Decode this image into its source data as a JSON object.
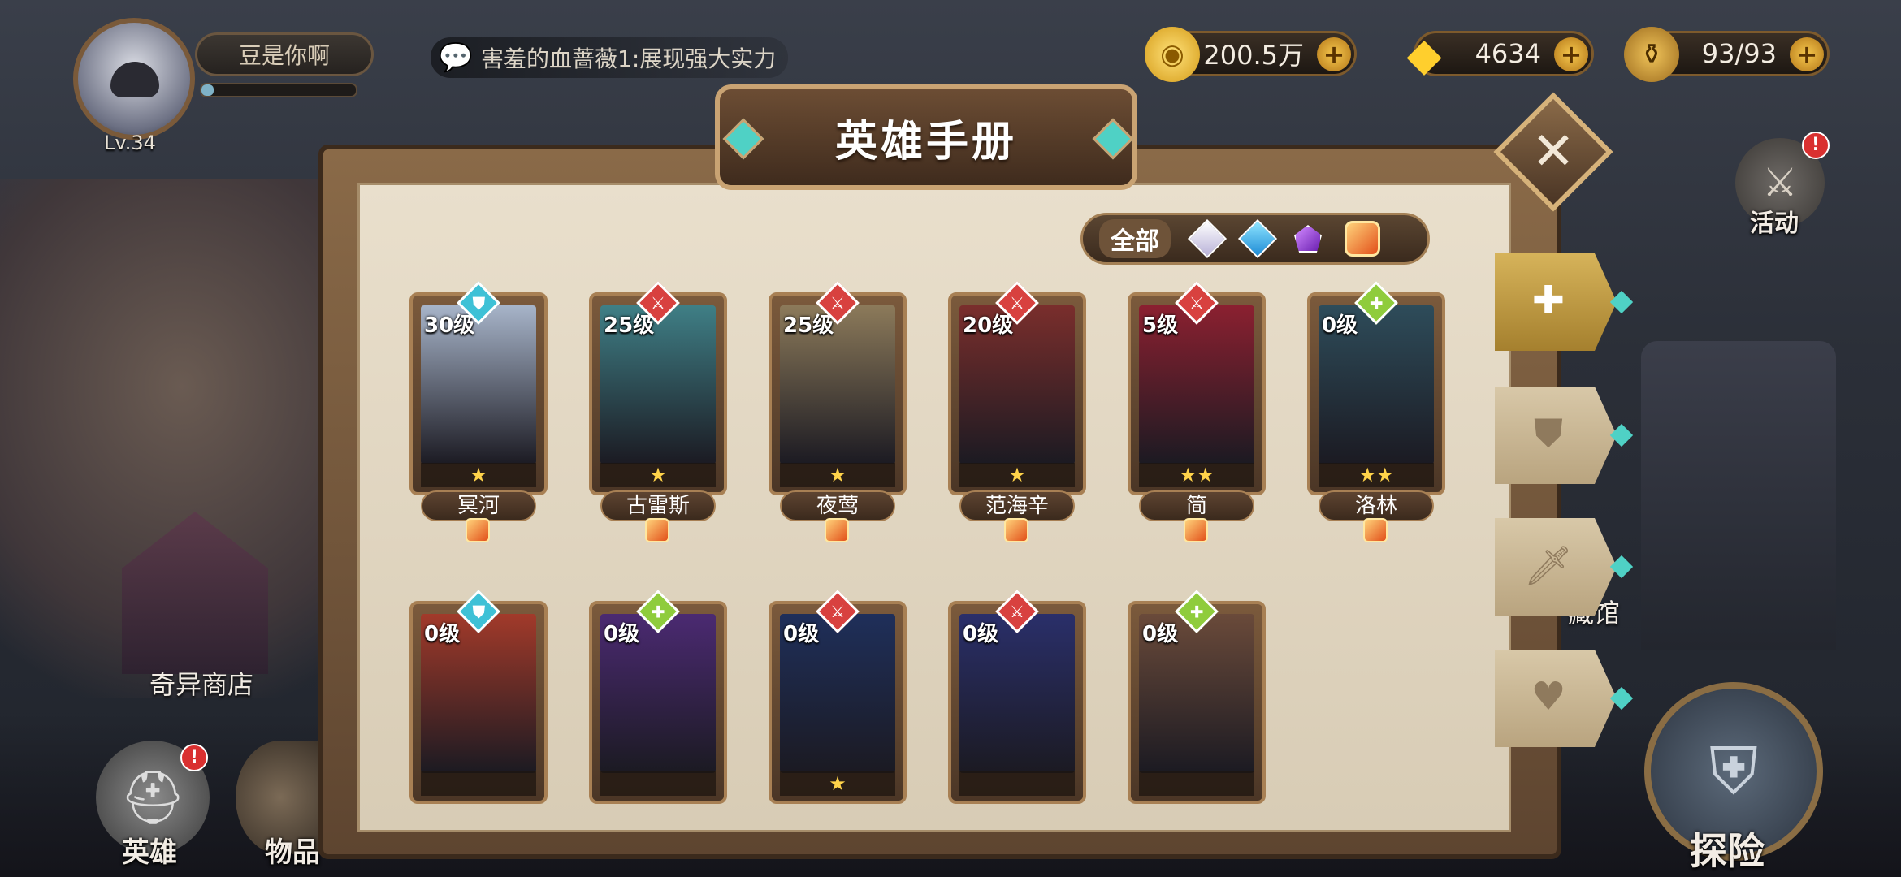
{
  "player": {
    "name": "豆是你啊",
    "level": "Lv.34",
    "exp_fraction": 0.08
  },
  "chat": {
    "message": "害羞的血蔷薇1:展现强大实力"
  },
  "currency": {
    "gold": {
      "value": "200.5万",
      "icon": "gold-coin-icon"
    },
    "diamond": {
      "value": "4634",
      "icon": "diamond-icon"
    },
    "stamina": {
      "value": "93/93",
      "icon": "stamina-icon"
    }
  },
  "panel": {
    "title": "英雄手册"
  },
  "filter": {
    "all_label": "全部",
    "options": [
      "white-gem",
      "blue-gem",
      "purple-gem",
      "orange-gem"
    ]
  },
  "heroes": [
    {
      "name": "冥河",
      "level": "30级",
      "stars": "★",
      "role": "shield",
      "color": "#a7b4c9"
    },
    {
      "name": "古雷斯",
      "level": "25级",
      "stars": "★",
      "role": "sword",
      "color": "#3f7f86"
    },
    {
      "name": "夜莺",
      "level": "25级",
      "stars": "★",
      "role": "sword",
      "color": "#8c7a5a"
    },
    {
      "name": "范海辛",
      "level": "20级",
      "stars": "★",
      "role": "sword",
      "color": "#7a2e2c"
    },
    {
      "name": "简",
      "level": "5级",
      "stars": "★★",
      "role": "sword",
      "color": "#8b2030"
    },
    {
      "name": "洛林",
      "level": "0级",
      "stars": "★★",
      "role": "heal",
      "color": "#2e4c5a"
    },
    {
      "name": "",
      "level": "0级",
      "stars": "",
      "role": "shield",
      "color": "#a23a2a"
    },
    {
      "name": "",
      "level": "0级",
      "stars": "",
      "role": "heal",
      "color": "#4b2a72"
    },
    {
      "name": "",
      "level": "0级",
      "stars": "★",
      "role": "sword",
      "color": "#1f2f5a"
    },
    {
      "name": "",
      "level": "0级",
      "stars": "",
      "role": "sword",
      "color": "#2a2f6a"
    },
    {
      "name": "",
      "level": "0级",
      "stars": "",
      "role": "heal",
      "color": "#6a4a3a"
    }
  ],
  "side_tabs": [
    "all-tab",
    "shield-tab",
    "sword-tab",
    "heart-tab"
  ],
  "hud": {
    "activity": "活动",
    "activity_badge": "!",
    "shop": "奇异商店",
    "hero": "英雄",
    "hero_badge": "!",
    "items": "物品",
    "collection": "藏馆",
    "explore": "探险"
  }
}
